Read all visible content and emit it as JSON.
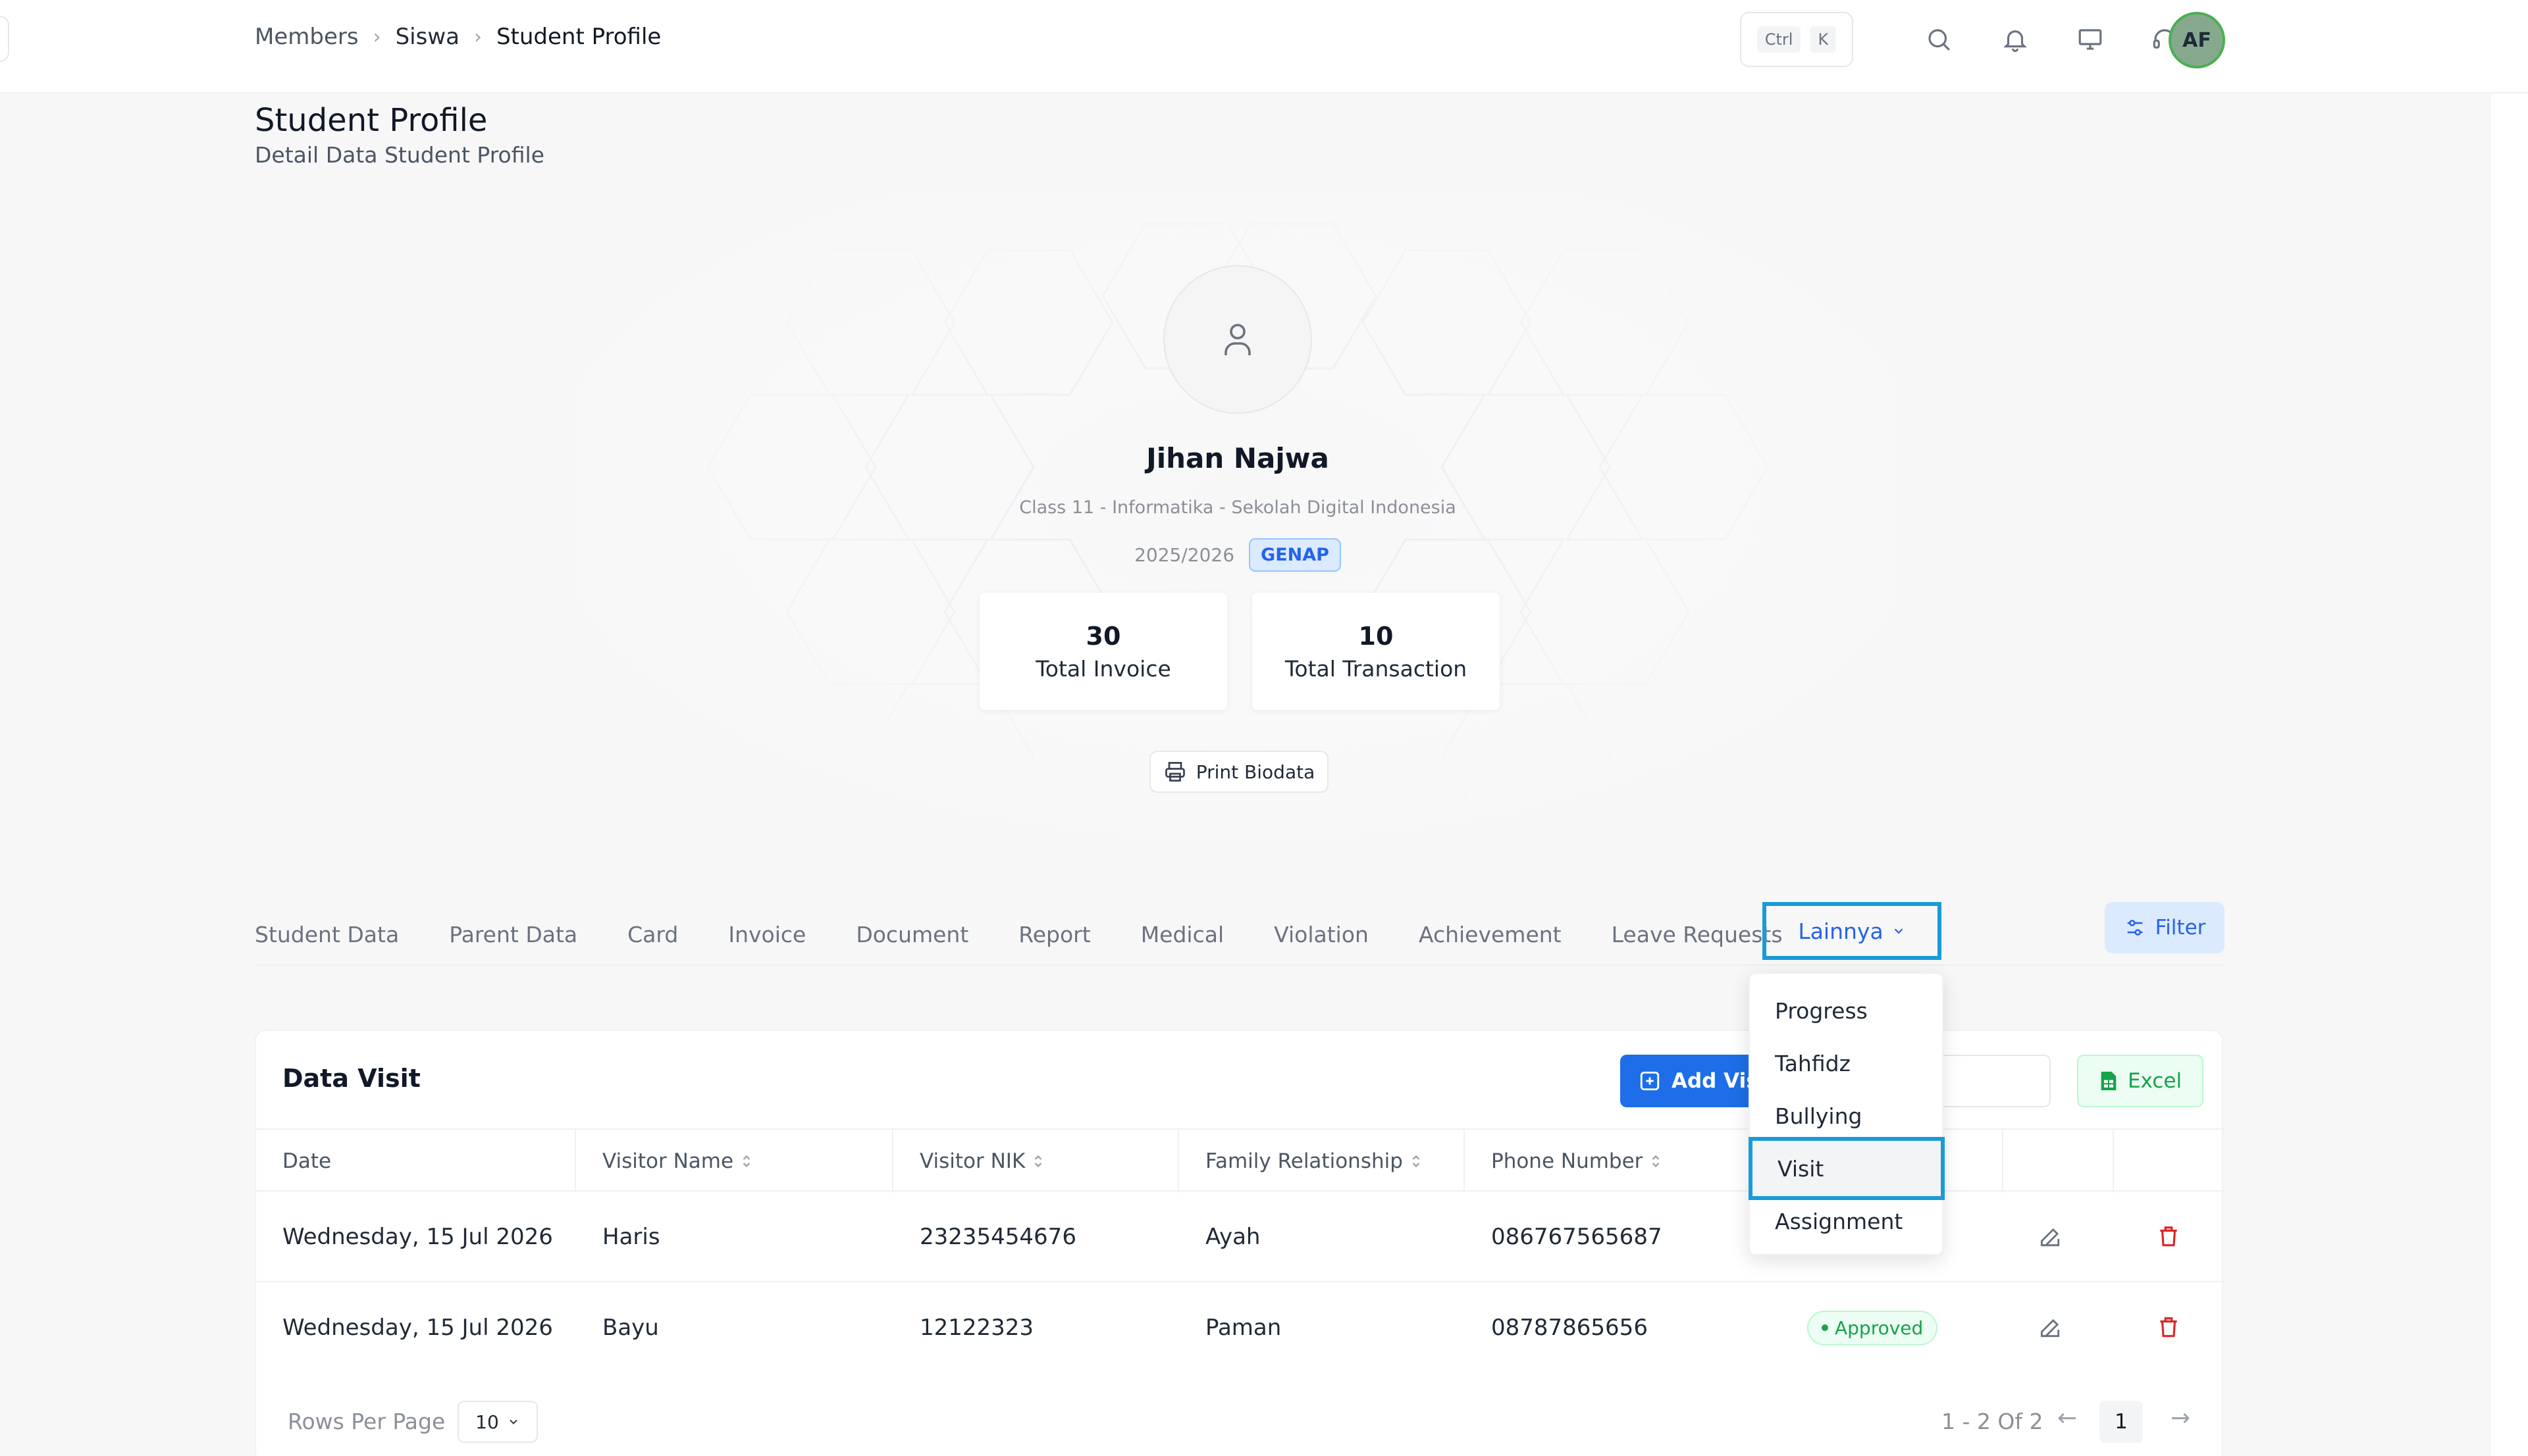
{
  "breadcrumb": {
    "items": [
      "Members",
      "Siswa",
      "Student Profile"
    ],
    "separator": "›"
  },
  "topbar": {
    "kbd_ctrl": "Ctrl",
    "kbd_k": "K",
    "avatar_initials": "AF",
    "icons": [
      "search-icon",
      "bell-icon",
      "monitor-icon",
      "headset-icon"
    ]
  },
  "page": {
    "title": "Student Profile",
    "subtitle": "Detail Data Student Profile"
  },
  "profile": {
    "name": "Jihan Najwa",
    "class_info": "Class 11 - Informatika - Sekolah Digital Indonesia",
    "year": "2025/2026",
    "semester_badge": "GENAP",
    "stats": [
      {
        "value": "30",
        "label": "Total Invoice"
      },
      {
        "value": "10",
        "label": "Total Transaction"
      }
    ],
    "print_label": "Print Biodata"
  },
  "tabs": {
    "items": [
      "Student Data",
      "Parent Data",
      "Card",
      "Invoice",
      "Document",
      "Report",
      "Medical",
      "Violation",
      "Achievement",
      "Leave Requests"
    ],
    "more_label": "Lainnya",
    "filter_label": "Filter"
  },
  "dropdown": {
    "items": [
      "Progress",
      "Tahfidz",
      "Bullying",
      "Visit",
      "Assignment"
    ],
    "active": "Visit"
  },
  "table": {
    "title": "Data Visit",
    "add_label": "Add Visit",
    "excel_label": "Excel",
    "columns": [
      "Date",
      "Visitor Name",
      "Visitor NIK",
      "Family Relationship",
      "Phone Number"
    ],
    "rows": [
      {
        "date": "Wednesday, 15 Jul 2026",
        "name": "Haris",
        "nik": "23235454676",
        "relation": "Ayah",
        "phone": "086767565687",
        "status": ""
      },
      {
        "date": "Wednesday, 15 Jul 2026",
        "name": "Bayu",
        "nik": "12122323",
        "relation": "Paman",
        "phone": "08787865656",
        "status": "Approved"
      }
    ]
  },
  "pagination": {
    "rows_label": "Rows Per Page",
    "rows_value": "10",
    "range": "1 - 2 Of 2",
    "current_page": "1",
    "prev": "←",
    "next": "→"
  },
  "colors": {
    "accent": "#1d6ee8",
    "highlight": "#1a9bd7",
    "success": "#16a34a",
    "danger": "#dc2626"
  }
}
